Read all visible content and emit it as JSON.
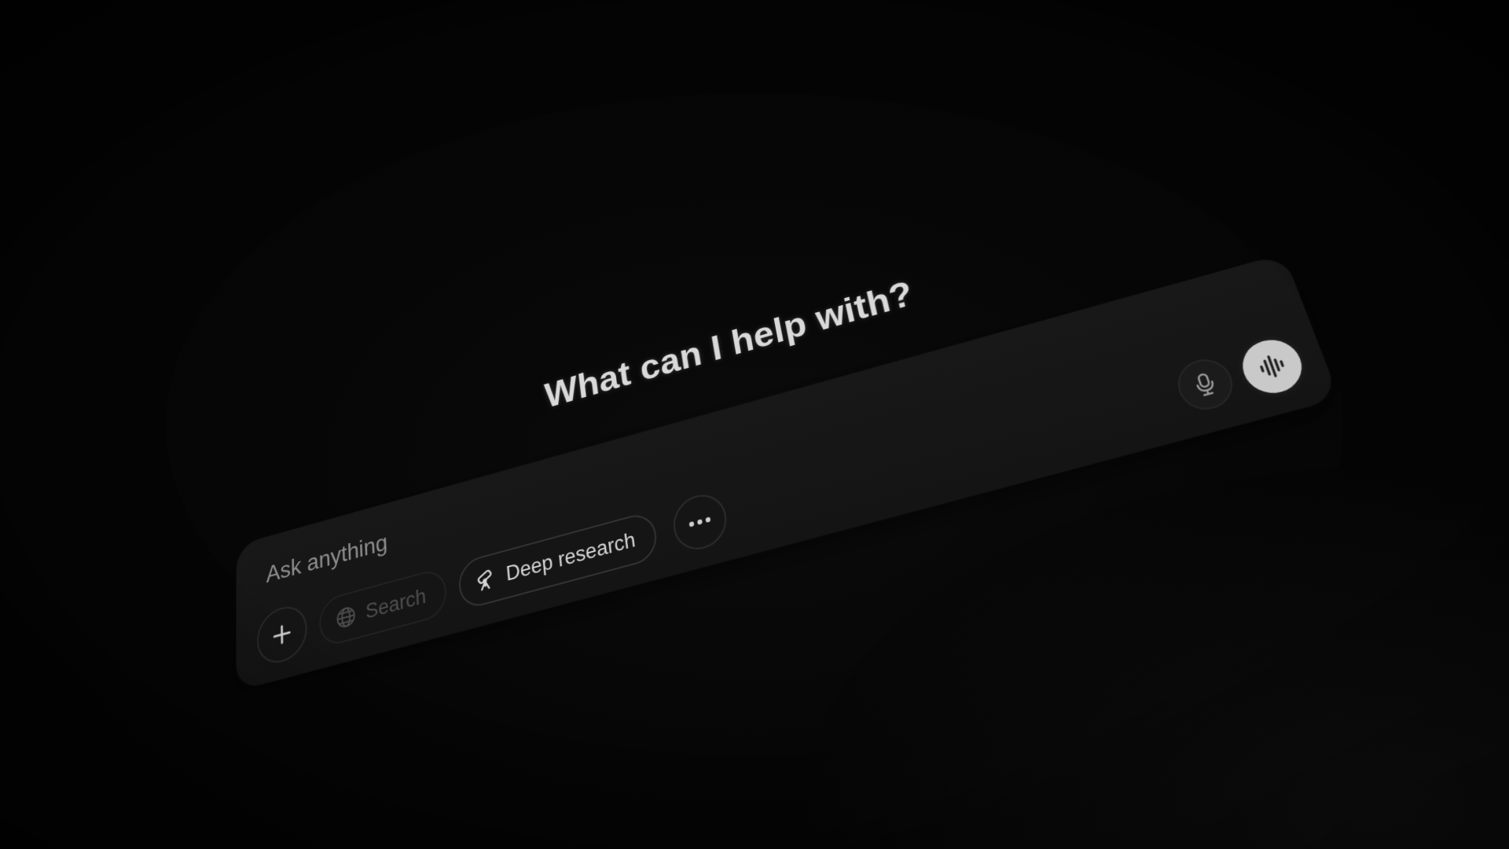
{
  "main": {
    "headline": "What can I help with?"
  },
  "composer": {
    "placeholder": "Ask anything",
    "tools": {
      "search_label": "Search",
      "deep_research_label": "Deep research"
    }
  },
  "icons": {
    "attach": "plus-icon",
    "search": "globe-icon",
    "deep_research": "telescope-icon",
    "more": "ellipsis-icon",
    "dictate": "microphone-icon",
    "voice": "waveform-icon"
  },
  "colors": {
    "background": "#050505",
    "composer": "#161616",
    "text_primary": "#d9d9d9",
    "text_placeholder": "#8e8e8e",
    "voice_button": "#c9c9c9"
  }
}
